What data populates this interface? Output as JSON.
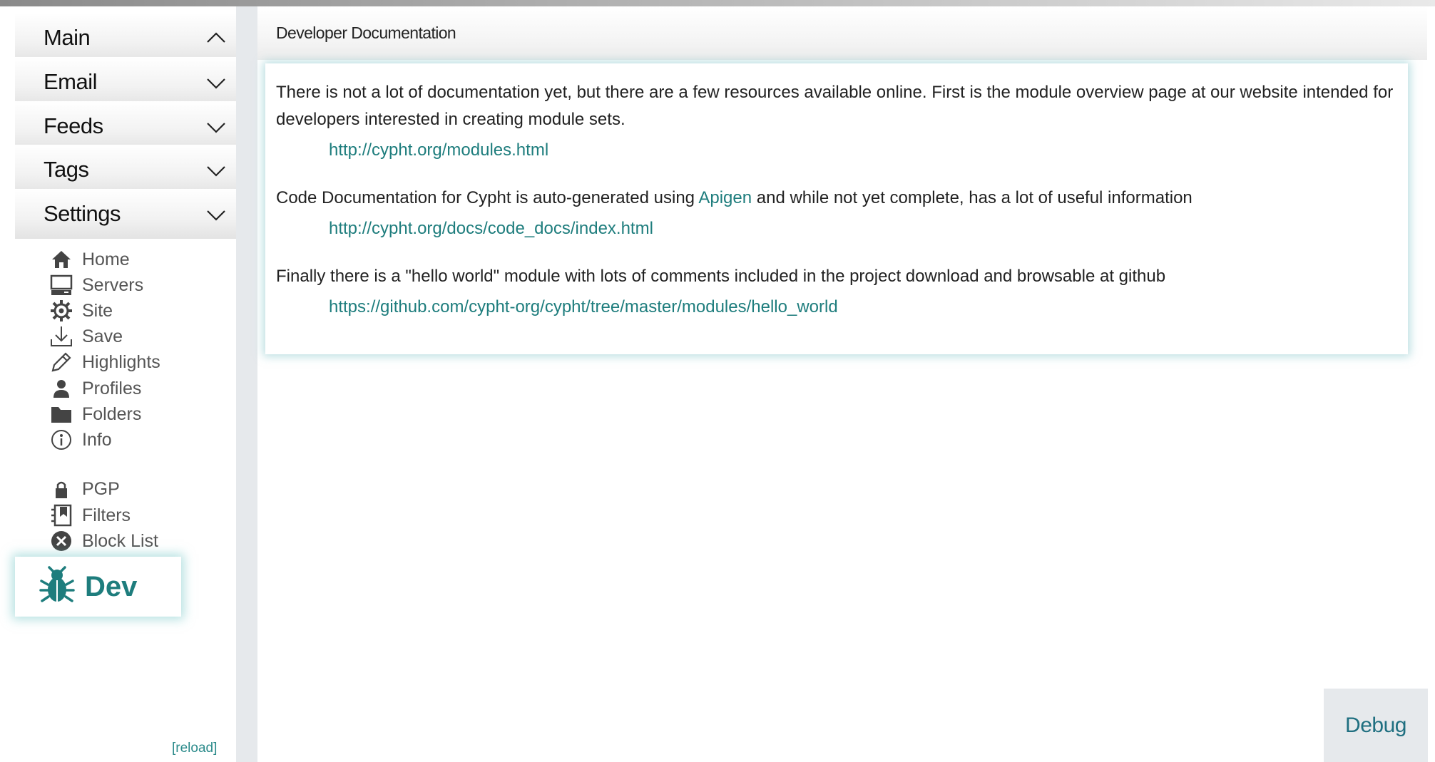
{
  "sidebar": {
    "sections": [
      {
        "label": "Main",
        "expanded": true
      },
      {
        "label": "Email",
        "expanded": false
      },
      {
        "label": "Feeds",
        "expanded": false
      },
      {
        "label": "Tags",
        "expanded": false
      },
      {
        "label": "Settings",
        "expanded": false
      }
    ],
    "items": [
      {
        "label": "Home",
        "icon": "home-icon"
      },
      {
        "label": "Servers",
        "icon": "servers-icon"
      },
      {
        "label": "Site",
        "icon": "gear-icon"
      },
      {
        "label": "Save",
        "icon": "download-icon"
      },
      {
        "label": "Highlights",
        "icon": "pencil-icon"
      },
      {
        "label": "Profiles",
        "icon": "person-icon"
      },
      {
        "label": "Folders",
        "icon": "folder-icon"
      },
      {
        "label": "Info",
        "icon": "info-icon"
      },
      {
        "label": "PGP",
        "icon": "lock-icon"
      },
      {
        "label": "Filters",
        "icon": "filters-icon"
      },
      {
        "label": "Block List",
        "icon": "close-circle-icon"
      }
    ],
    "reload_label": "[reload]",
    "dev_popup": {
      "label": "Dev",
      "icon": "bug-icon"
    }
  },
  "main": {
    "title": "Developer Documentation",
    "para1": "There is not a lot of documentation yet, but there are a few resources available online. First is the module overview page at our website intended for developers interested in creating module sets.",
    "link1": "http://cypht.org/modules.html",
    "para2_before": "Code Documentation for Cypht is auto-generated using ",
    "para2_link": "Apigen",
    "para2_after": " and while not yet complete, has a lot of useful information",
    "link2": "http://cypht.org/docs/code_docs/index.html",
    "para3": "Finally there is a \"hello world\" module with lots of comments included in the project download and browsable at github",
    "link3": "https://github.com/cypht-org/cypht/tree/master/modules/hello_world"
  },
  "debug_label": "Debug",
  "colors": {
    "accent": "#1e7d7d",
    "rail": "#e6e9ec"
  }
}
